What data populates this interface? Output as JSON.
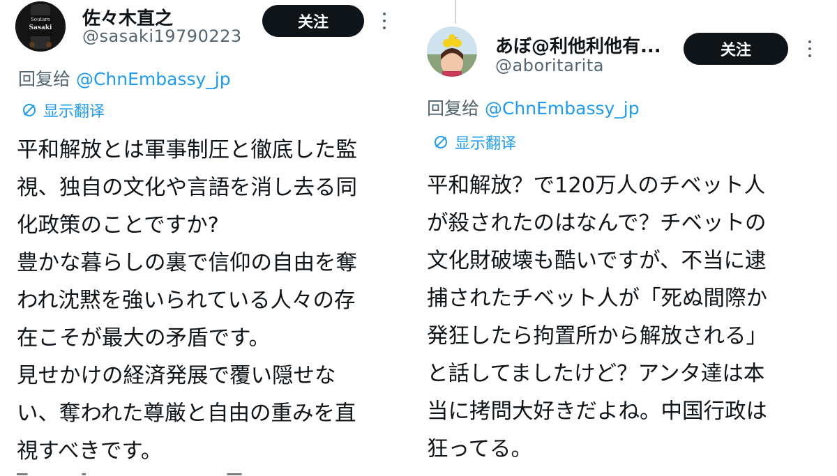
{
  "left_tweet": {
    "display_name": "佐々木直之",
    "handle": "@sasaki19790223",
    "follow_label": "关注",
    "reply_prefix": "回复给",
    "reply_to": "@ChnEmbassy_jp",
    "translate_label": "显示翻译",
    "avatar_text": "Sasaki",
    "body_lines": [
      "平和解放とは軍事制圧と徹底した監",
      "視、独自の文化や言語を消し去る同",
      "化政策のことですか?",
      "豊かな暮らしの裏で信仰の自由を奪",
      "われ沈黙を強いられている人々の存",
      "在こそが最大の矛盾です。",
      "見せかけの経済発展で覆い隠せな",
      "い、奪われた尊厳と自由の重みを直",
      "視すべきです。"
    ]
  },
  "right_tweet": {
    "display_name": "あぼ@利他利他有...",
    "handle": "@aboritarita",
    "follow_label": "关注",
    "reply_prefix": "回复给",
    "reply_to": "@ChnEmbassy_jp",
    "translate_label": "显示翻译",
    "body_lines": [
      "平和解放？で120万人のチベット人",
      "が殺されたのはなんで？チベットの",
      "文化財破壊も酷いですが、不当に逮",
      "捕されたチベット人が「死ぬ間際か",
      "発狂したら拘置所から解放される」",
      "と話してましたけど？アンタ達は本",
      "当に拷問大好きだよね。中国行政は",
      "狂ってる。"
    ]
  },
  "colors": {
    "text": "#0f1419",
    "secondary": "#536471",
    "link": "#1d9bf0",
    "button": "#0f1419"
  }
}
